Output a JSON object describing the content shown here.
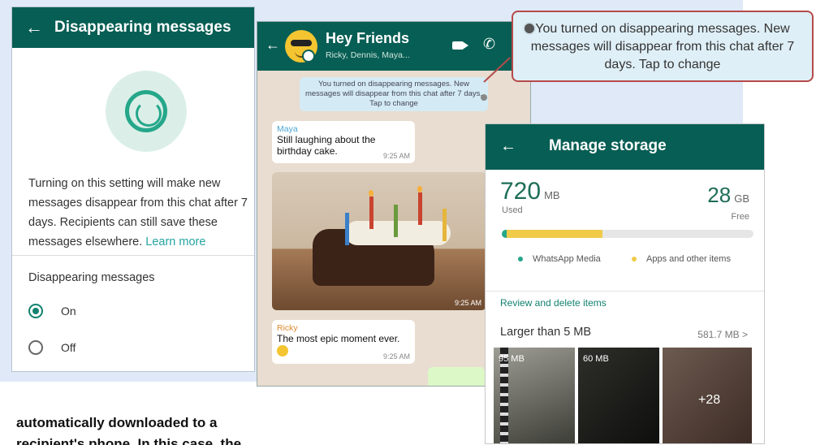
{
  "screen1": {
    "header": {
      "back_glyph": "←",
      "title": "Disappearing messages"
    },
    "description": "Turning on this setting will make new messages disappear from this chat after 7 days. Recipients can still save these messages elsewhere.",
    "learn_more": "Learn more",
    "section_label": "Disappearing messages",
    "options": [
      {
        "label": "On",
        "selected": true
      },
      {
        "label": "Off",
        "selected": false
      }
    ]
  },
  "screen2": {
    "header": {
      "back_glyph": "←",
      "name": "Hey Friends",
      "members": "Ricky, Dennis, Maya..."
    },
    "system_message": "You turned on disappearing messages. New messages will disappear from this chat after 7 days. Tap to change",
    "messages": [
      {
        "sender": "Maya",
        "text": "Still laughing about the birthday cake.",
        "time": "9:25 AM",
        "sender_color": "#4aa6d4"
      },
      {
        "type": "photo",
        "time": "9:25 AM"
      },
      {
        "sender": "Ricky",
        "text": "The most epic moment ever.",
        "time": "9:25 AM",
        "sender_color": "#e08a2e"
      }
    ]
  },
  "callout": {
    "text": "You turned on disappearing messages. New messages will disappear from this chat after 7 days. Tap to change",
    "border_color": "#b64a4a"
  },
  "screen3": {
    "header": {
      "back_glyph": "←",
      "title": "Manage storage"
    },
    "used_value": "720",
    "used_unit": "MB",
    "used_label": "Used",
    "free_value": "28",
    "free_unit": "GB",
    "free_label": "Free",
    "usage_share": {
      "whatsapp_media": 0.02,
      "apps_and_other": 0.38
    },
    "legend": [
      {
        "label": "WhatsApp Media",
        "color": "#25a78a"
      },
      {
        "label": "Apps and other items",
        "color": "#f0cb49"
      }
    ],
    "review_label": "Review and delete items",
    "larger_label": "Larger than 5 MB",
    "larger_size": "581.7 MB",
    "chevron": ">",
    "thumbnails": [
      {
        "label": "95 MB"
      },
      {
        "label": "60 MB"
      },
      {
        "label": "+28"
      }
    ]
  },
  "article": {
    "lines": [
      "automatically downloaded to a",
      "recipient's phone. In this case, the"
    ]
  },
  "colors": {
    "whatsapp_teal": "#075e54",
    "accent_green": "#25a78a"
  }
}
